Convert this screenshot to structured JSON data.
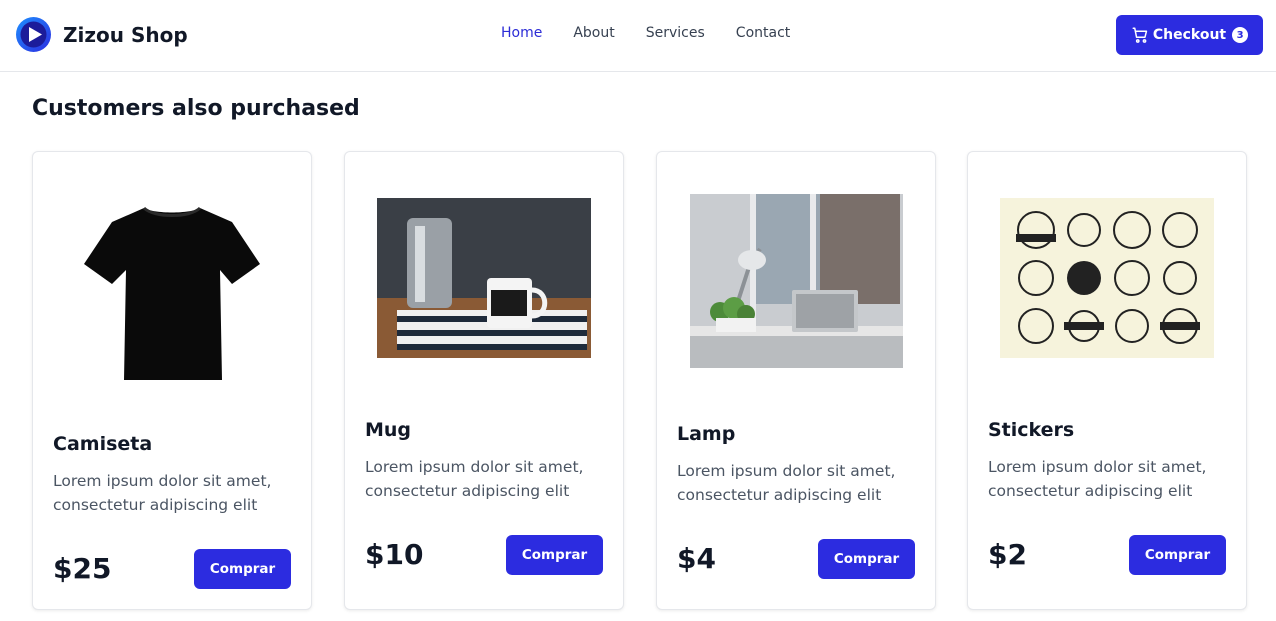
{
  "navbar": {
    "brand_name": "Zizou Shop",
    "links": [
      "Home",
      "About",
      "Services",
      "Contact"
    ],
    "active_link": "Home",
    "checkout_label": "Checkout",
    "cart_count": "3",
    "accent_color": "#2c2ce0"
  },
  "section": {
    "title": "Customers also purchased"
  },
  "products": [
    {
      "name": "Camiseta",
      "description": "Lorem ipsum dolor sit amet, consectetur adipiscing elit",
      "price": "$25",
      "button": "Comprar",
      "image": "black-tshirt"
    },
    {
      "name": "Mug",
      "description": "Lorem ipsum dolor sit amet, consectetur adipiscing elit",
      "price": "$10",
      "button": "Comprar",
      "image": "coffee-mug-photo"
    },
    {
      "name": "Lamp",
      "description": "Lorem ipsum dolor sit amet, consectetur adipiscing elit",
      "price": "$4",
      "button": "Comprar",
      "image": "desk-lamp-photo"
    },
    {
      "name": "Stickers",
      "description": "Lorem ipsum dolor sit amet, consectetur adipiscing elit",
      "price": "$2",
      "button": "Comprar",
      "image": "stickers-sheet"
    }
  ]
}
